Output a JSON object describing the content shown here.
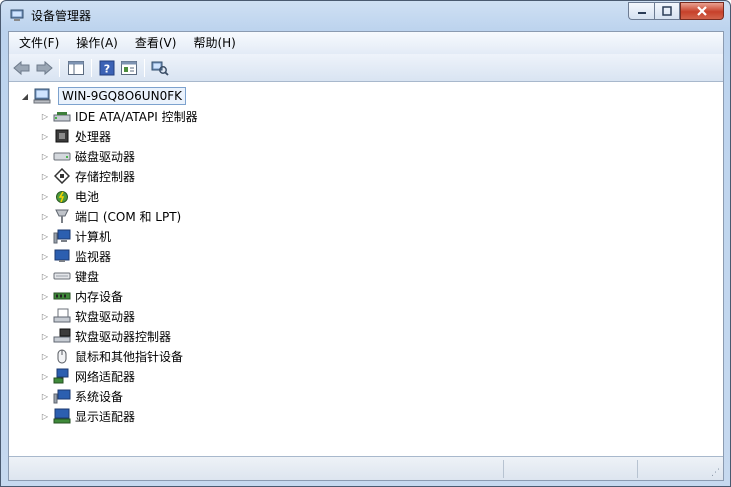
{
  "window": {
    "title": "设备管理器"
  },
  "menubar": {
    "items": [
      {
        "label": "文件(F)"
      },
      {
        "label": "操作(A)"
      },
      {
        "label": "查看(V)"
      },
      {
        "label": "帮助(H)"
      }
    ]
  },
  "toolbar": {
    "buttons": [
      "back-icon",
      "forward-icon",
      "show-hide-console-tree-icon",
      "help-icon",
      "properties-icon",
      "scan-hardware-changes-icon"
    ]
  },
  "tree": {
    "root": {
      "label": "WIN-9GQ8O6UN0FK",
      "icon": "computer-icon"
    },
    "nodes": [
      {
        "label": "IDE ATA/ATAPI 控制器",
        "icon": "ide-controller-icon"
      },
      {
        "label": "处理器",
        "icon": "processor-icon"
      },
      {
        "label": "磁盘驱动器",
        "icon": "disk-drive-icon"
      },
      {
        "label": "存储控制器",
        "icon": "storage-controller-icon"
      },
      {
        "label": "电池",
        "icon": "battery-icon"
      },
      {
        "label": "端口 (COM 和 LPT)",
        "icon": "port-icon"
      },
      {
        "label": "计算机",
        "icon": "computer-icon"
      },
      {
        "label": "监视器",
        "icon": "monitor-icon"
      },
      {
        "label": "键盘",
        "icon": "keyboard-icon"
      },
      {
        "label": "内存设备",
        "icon": "memory-icon"
      },
      {
        "label": "软盘驱动器",
        "icon": "floppy-drive-icon"
      },
      {
        "label": "软盘驱动器控制器",
        "icon": "floppy-controller-icon"
      },
      {
        "label": "鼠标和其他指针设备",
        "icon": "mouse-icon"
      },
      {
        "label": "网络适配器",
        "icon": "network-adapter-icon"
      },
      {
        "label": "系统设备",
        "icon": "system-device-icon"
      },
      {
        "label": "显示适配器",
        "icon": "display-adapter-icon"
      }
    ]
  },
  "colors": {
    "title_bar": "#bcd3ee",
    "close_button": "#c7412a",
    "selection_border": "#7da2ce"
  }
}
